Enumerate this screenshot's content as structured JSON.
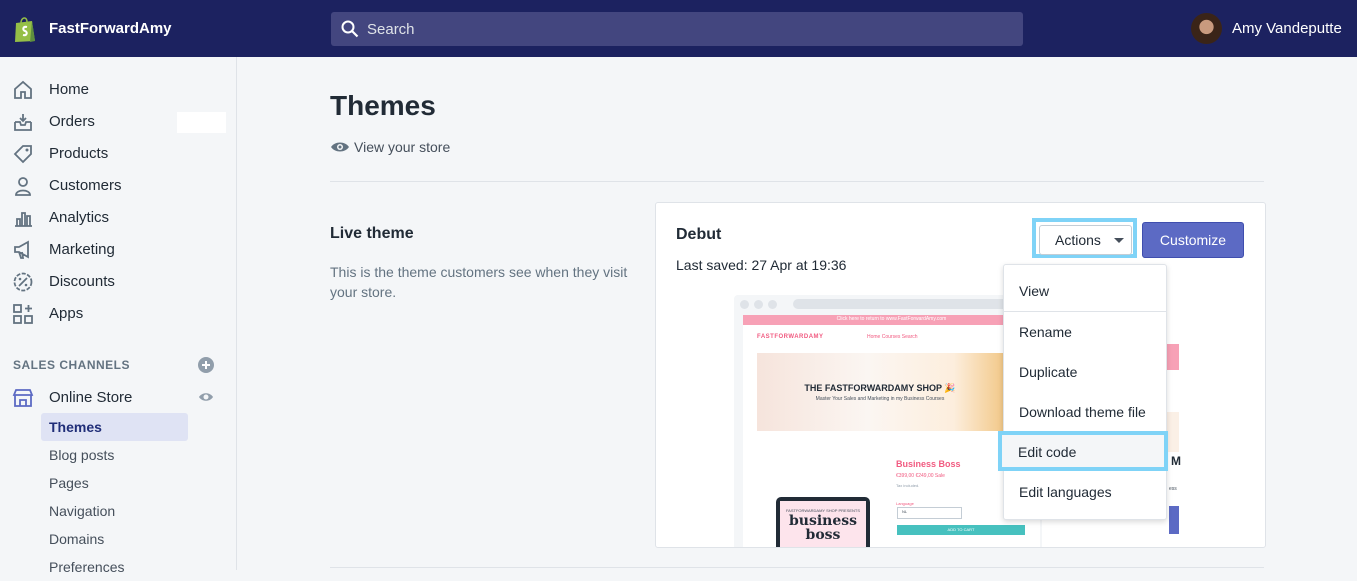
{
  "topbar": {
    "store_name": "FastForwardAmy",
    "search_placeholder": "Search",
    "user_name": "Amy Vandeputte",
    "logo_icon": "shopify-bag-icon"
  },
  "sidebar": {
    "items": [
      {
        "label": "Home",
        "icon": "home-icon"
      },
      {
        "label": "Orders",
        "icon": "orders-icon"
      },
      {
        "label": "Products",
        "icon": "tag-icon"
      },
      {
        "label": "Customers",
        "icon": "person-icon"
      },
      {
        "label": "Analytics",
        "icon": "bar-chart-icon"
      },
      {
        "label": "Marketing",
        "icon": "megaphone-icon"
      },
      {
        "label": "Discounts",
        "icon": "discount-icon"
      },
      {
        "label": "Apps",
        "icon": "apps-icon"
      }
    ],
    "sales_channels_title": "SALES CHANNELS",
    "online_store_label": "Online Store",
    "sub_items": [
      "Themes",
      "Blog posts",
      "Pages",
      "Navigation",
      "Domains",
      "Preferences"
    ]
  },
  "main": {
    "title": "Themes",
    "view_store": "View your store",
    "live_theme": {
      "title": "Live theme",
      "description": "This is the theme customers see when they visit your store."
    },
    "theme_card": {
      "name": "Debut",
      "last_saved": "Last saved: 27 Apr at 19:36",
      "actions_label": "Actions",
      "customize_label": "Customize"
    },
    "actions_menu": [
      "View",
      "Rename",
      "Duplicate",
      "Download theme file",
      "Edit code",
      "Edit languages"
    ],
    "preview": {
      "announcement": "Click here to return to www.FastForwardAmy.com",
      "brand": "FASTFORWARDAMY",
      "nav": "Home   Courses   Search",
      "hero_title": "THE FASTFORWARDAMY SHOP 🎉",
      "hero_subtitle": "Master Your Sales and Marketing in my Business Courses",
      "product_title": "Business Boss",
      "price": "€399,00  €249,00 Sale",
      "tax": "Tax included.",
      "language_label": "Language",
      "language_value": "NL",
      "cart_label": "ADD TO CART",
      "tablet_small": "FASTFORWARDAMY SHOP PRESENTS",
      "tablet_big": "business boss",
      "phone_letter": "M",
      "phone_text": "ess"
    }
  },
  "colors": {
    "topbar": "#1c2260",
    "accent": "#5c6ac4",
    "highlight": "#7fd3f7",
    "shopify_green": "#95bf47"
  }
}
